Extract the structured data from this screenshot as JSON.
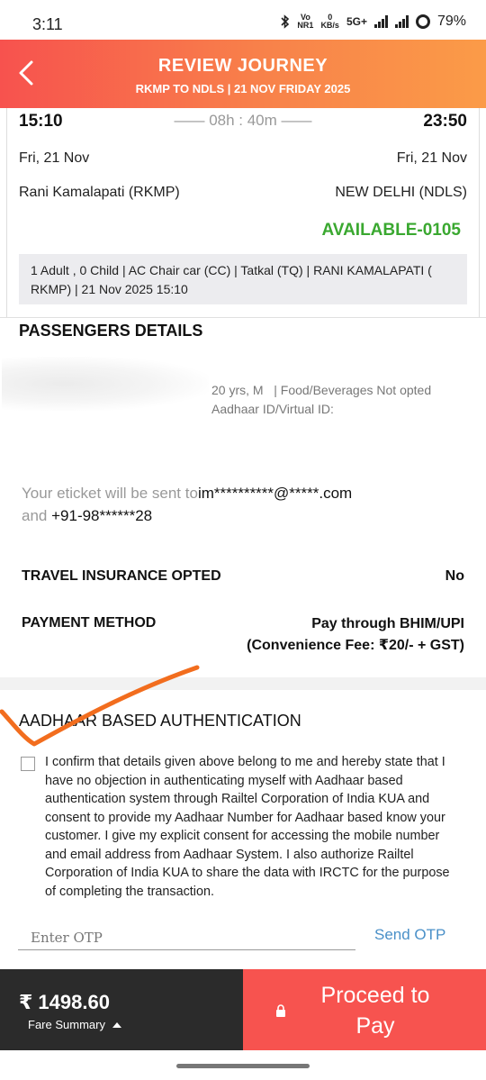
{
  "status_bar": {
    "time": "3:11",
    "volte_top": "Vo",
    "volte_bottom": "NR1",
    "speed_top": "0",
    "speed_bottom": "KB/s",
    "network": "5G+",
    "battery": "79%"
  },
  "header": {
    "title": "REVIEW JOURNEY",
    "subtitle": "RKMP TO NDLS | 21 NOV FRIDAY 2025"
  },
  "journey": {
    "departure_time": "15:10",
    "duration": "—— 08h : 40m ——",
    "arrival_time": "23:50",
    "departure_date": "Fri, 21 Nov",
    "arrival_date": "Fri, 21 Nov",
    "from_station": "Rani Kamalapati (RKMP)",
    "to_station": "NEW DELHI (NDLS)",
    "availability": "AVAILABLE-0105",
    "availability_color": "#3aa830",
    "booking_info": "1 Adult , 0 Child  | AC Chair car (CC) | Tatkal (TQ) | RANI KAMALAPATI ( RKMP) | 21 Nov 2025 15:10"
  },
  "passengers": {
    "title": "PASSENGERS DETAILS",
    "age_gender": "20 yrs, M",
    "food": "| Food/Beverages Not opted",
    "aadhaar_label": "Aadhaar ID/Virtual ID:"
  },
  "eticket": {
    "prefix": "Your eticket will be sent to",
    "email": "im**********@*****.com",
    "and": "and",
    "phone": "+91-98******28"
  },
  "insurance": {
    "label": "TRAVEL INSURANCE OPTED",
    "value": "No"
  },
  "payment": {
    "label": "PAYMENT METHOD",
    "value": "Pay through BHIM/UPI",
    "fee": "(Convenience Fee: ₹20/- + GST)"
  },
  "aadhaar": {
    "title": "AADHAAR BASED AUTHENTICATION",
    "consent_text": "I confirm that details given above belong to me and hereby state that I have no objection in authenticating myself with Aadhaar based authentication system through Railtel Corporation of India KUA and consent to provide my Aadhaar Number for Aadhaar based know your customer. I give my explicit consent for accessing the mobile number and email address from Aadhaar System. I also authorize Railtel Corporation of India KUA to share the data with IRCTC for the purpose of completing the transaction.",
    "otp_placeholder": "Enter OTP",
    "otp_value": "",
    "send_otp": "Send OTP"
  },
  "footer": {
    "amount": "₹ 1498.60",
    "fare_summary": "Fare Summary",
    "proceed": "Proceed to Pay",
    "proceed_color": "#f7534f"
  }
}
